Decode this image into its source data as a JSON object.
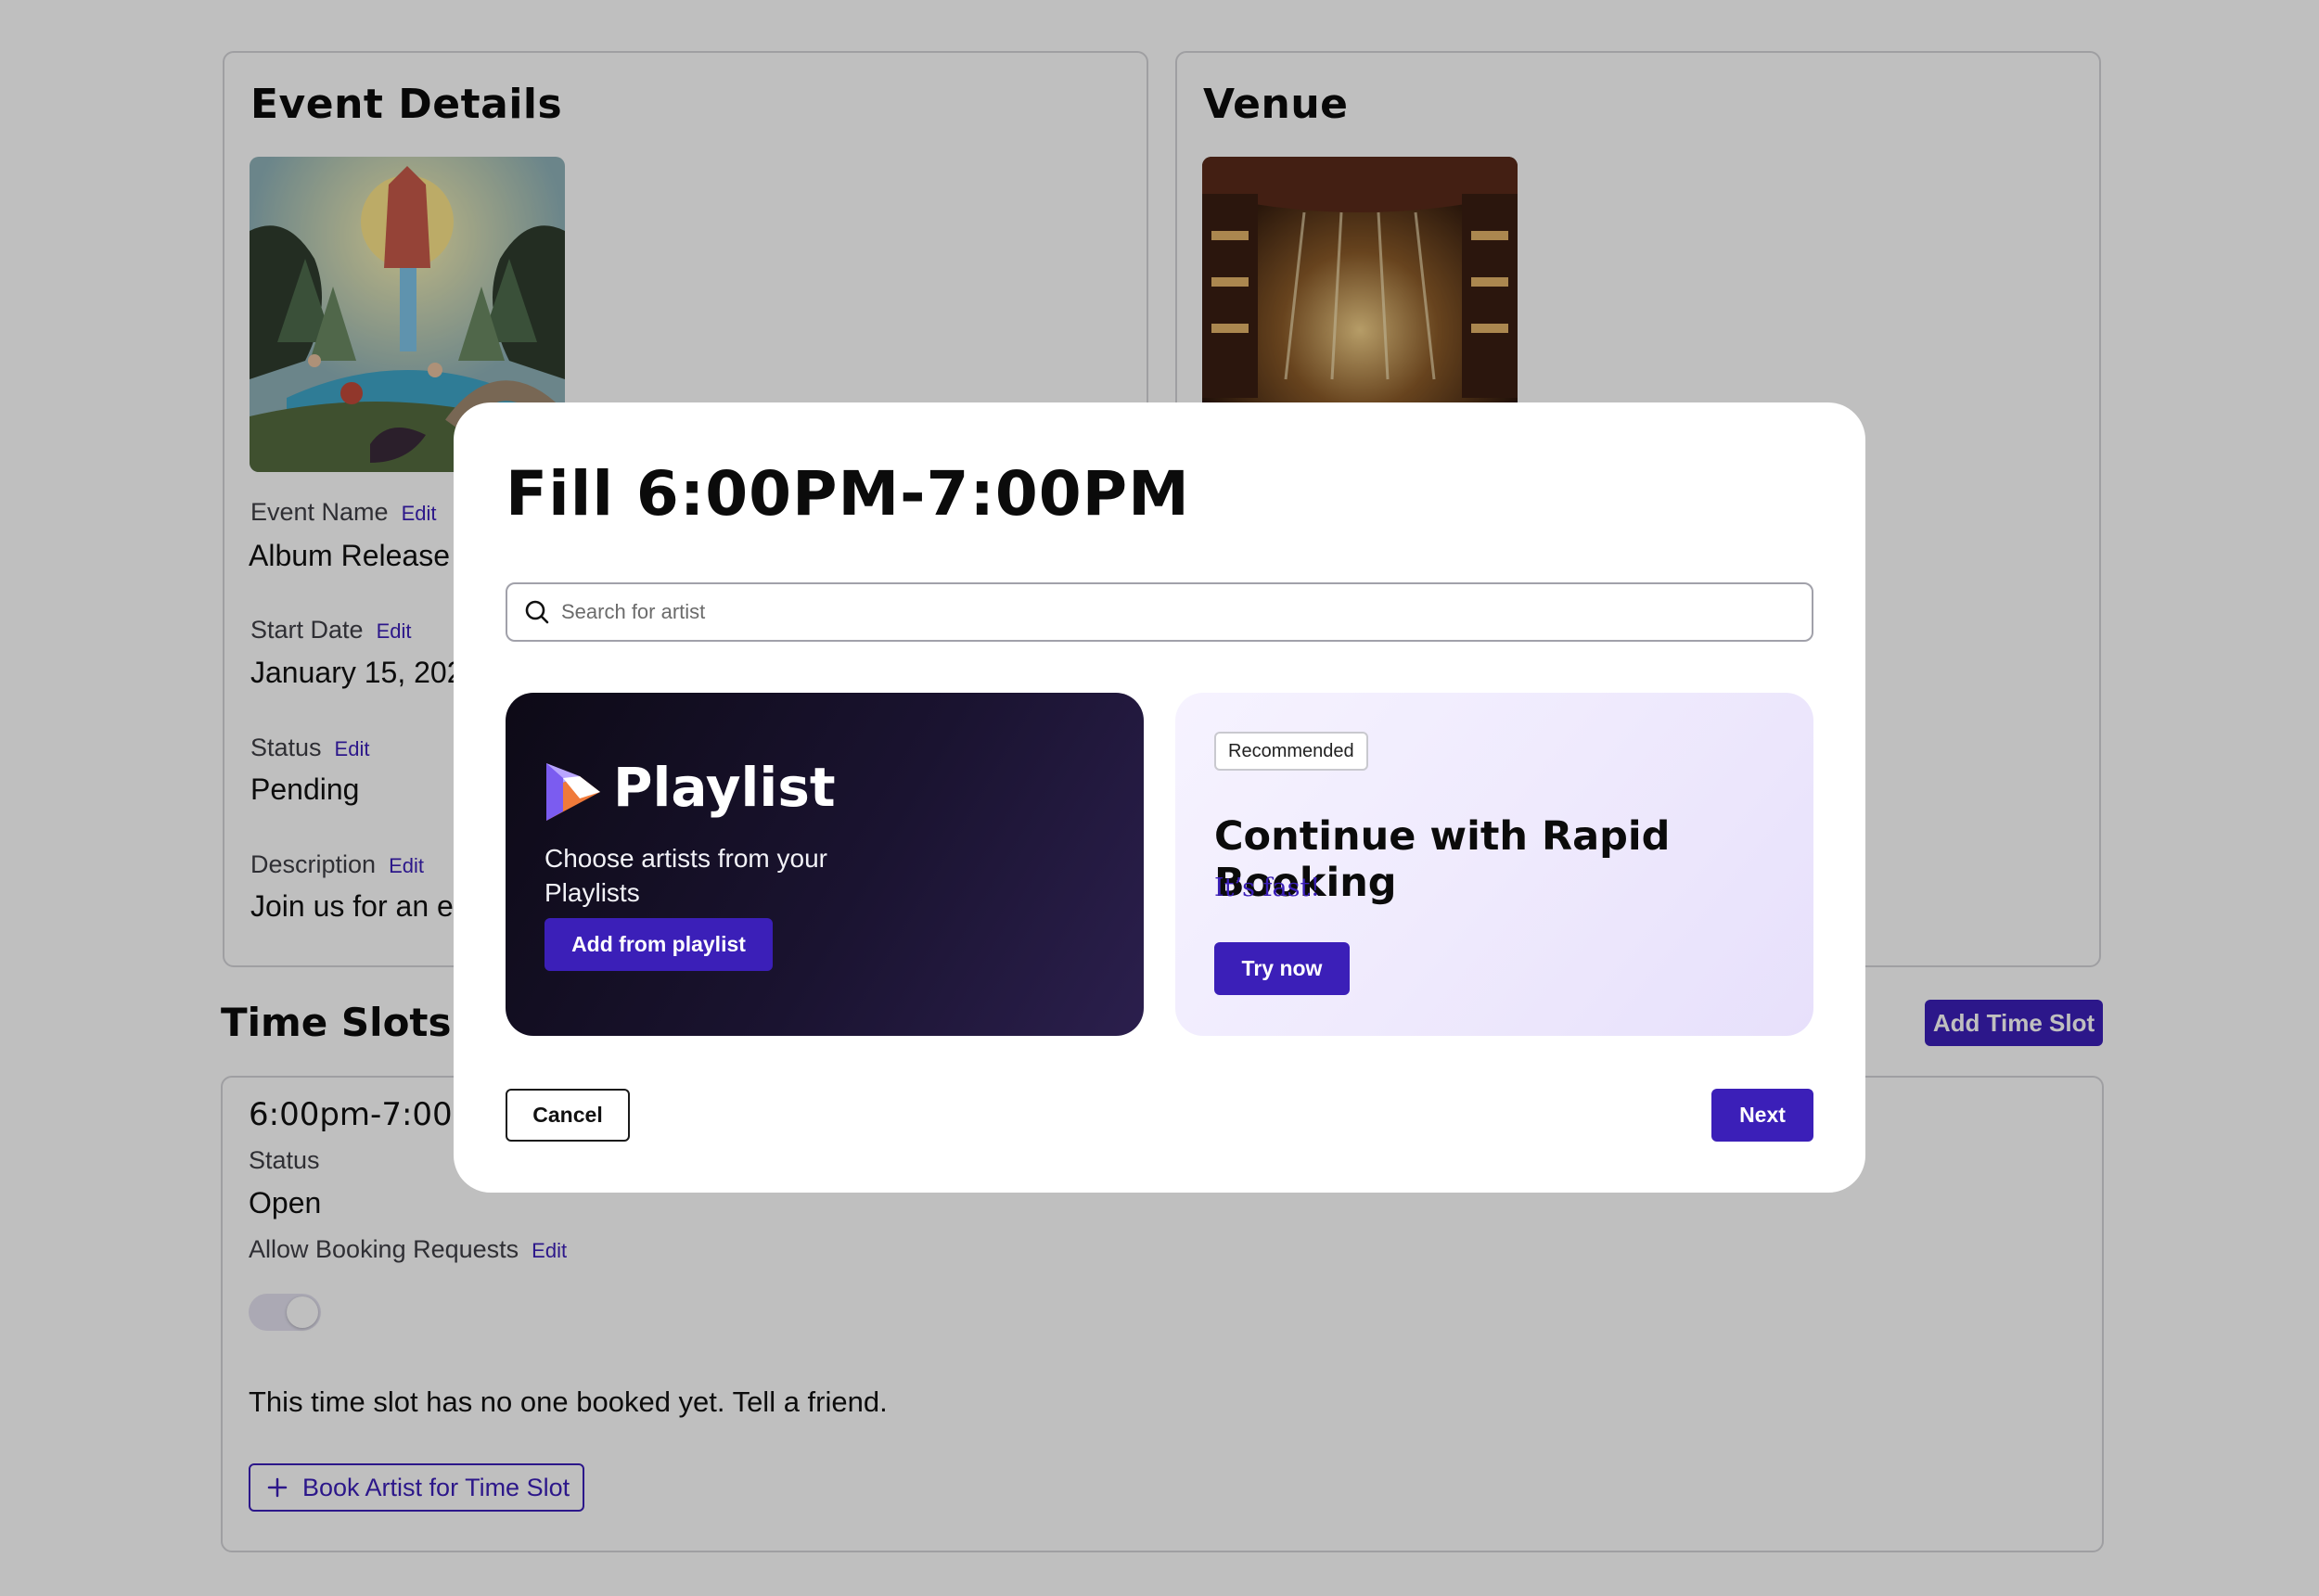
{
  "event_details": {
    "title": "Event Details",
    "fields": [
      {
        "label": "Event Name",
        "edit": "Edit",
        "value": "Album Release"
      },
      {
        "label": "Start Date",
        "edit": "Edit",
        "value": "January 15, 2025"
      },
      {
        "label": "Status",
        "edit": "Edit",
        "value": "Pending"
      },
      {
        "label": "Description",
        "edit": "Edit",
        "value": "Join us for an ev"
      }
    ]
  },
  "venue": {
    "title": "Venue"
  },
  "time_slots": {
    "title": "Time Slots",
    "add_button": "Add Time Slot",
    "slot": {
      "time": "6:00pm-7:00p",
      "status_label": "Status",
      "status_value": "Open",
      "allow_label": "Allow Booking Requests",
      "allow_edit": "Edit",
      "allow_enabled": true,
      "empty_message": "This time slot has no one booked yet. Tell a friend.",
      "book_button": "Book Artist for Time Slot",
      "book_icon": "plus-icon"
    }
  },
  "modal": {
    "title": "Fill 6:00PM-7:00PM",
    "search": {
      "placeholder": "Search for artist",
      "value": "",
      "icon": "search-icon"
    },
    "playlist_card": {
      "logo_icon": "playlist-logo-icon",
      "name": "Playlist",
      "description": "Choose artists from your Playlists",
      "button": "Add from playlist"
    },
    "rapid_card": {
      "badge": "Recommended",
      "title": "Continue with Rapid Booking",
      "subtitle": "It’s fast!",
      "button": "Try now"
    },
    "cancel_button": "Cancel",
    "next_button": "Next"
  },
  "colors": {
    "accent": "#3b1fb8",
    "overlay": "rgba(0,0,0,0.25)",
    "playlist_bg": "#1a1330",
    "rapid_bg": "#efeafd"
  }
}
